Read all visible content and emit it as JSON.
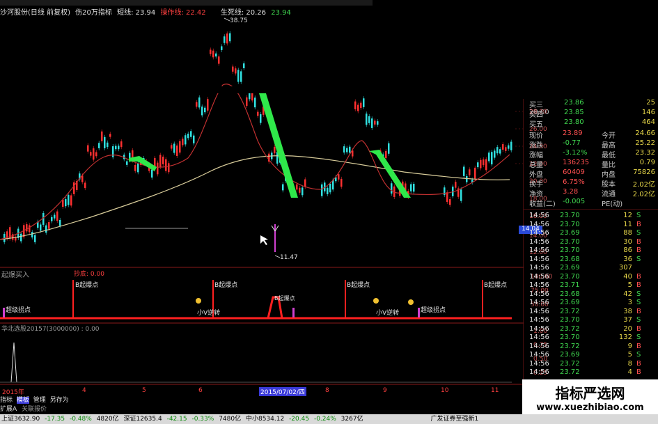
{
  "title_row": {
    "stock": "沙河股份(日线 前复权)",
    "indicator": "伤20万指标",
    "line1_label": "短线: 23.94",
    "line2_label": "操作线: 22.42",
    "line3_label": "生死线: 20.26",
    "line4_value": "23.94"
  },
  "price_labels": {
    "high": "38.75",
    "low": "11.47",
    "current_tag": "14.04"
  },
  "price_axis": [
    "28.00",
    "26.00",
    "24.00",
    "22.00",
    "20.00",
    "18.00",
    "16.00",
    "14.00",
    "12.00"
  ],
  "indicator1": {
    "name": "起爆买入",
    "sub": "抄底: 0.00",
    "axis": [
      "100.00",
      "75.00",
      "50.00"
    ],
    "annotations": [
      "B起爆点",
      "B起爆点",
      "B起爆点",
      "B起爆点",
      "B起爆点"
    ],
    "extra_labels": [
      "超级拐点",
      "小V逆转",
      "小V逆转",
      "超级拐点"
    ]
  },
  "indicator2": {
    "name": "华北选股20157(3000000) : 0.00",
    "axis": [
      "1.00",
      "0.75",
      "0.50",
      "0.25"
    ]
  },
  "time_axis": {
    "year": "2015年",
    "ticks": [
      "4",
      "5",
      "6",
      "8",
      "9",
      "10",
      "11"
    ],
    "cursor": "2015/07/02/四"
  },
  "tabs": [
    "指标",
    "模板",
    "管理",
    "另存为"
  ],
  "tabs2": [
    "扩展A",
    "关联报价"
  ],
  "quote": {
    "buy": [
      {
        "label": "买三",
        "price": "23.86",
        "vol": "25"
      },
      {
        "label": "买四",
        "price": "23.85",
        "vol": "146"
      },
      {
        "label": "买五",
        "price": "23.80",
        "vol": "464"
      }
    ],
    "stats": [
      {
        "l1": "现价",
        "v1": "23.89",
        "l2": "今开",
        "v2": "24.66"
      },
      {
        "l1": "涨跌",
        "v1": "-0.77",
        "l2": "最高",
        "v2": "25.22"
      },
      {
        "l1": "涨幅",
        "v1": "-3.12%",
        "l2": "最低",
        "v2": "23.32"
      },
      {
        "l1": "总量",
        "v1": "136235",
        "l2": "量比",
        "v2": "0.79"
      },
      {
        "l1": "外盘",
        "v1": "60409",
        "l2": "内盘",
        "v2": "75826"
      },
      {
        "l1": "换手",
        "v1": "6.75%",
        "l2": "股本",
        "v2": "2.02亿"
      },
      {
        "l1": "净资",
        "v1": "3.28",
        "l2": "流通",
        "v2": "2.02亿"
      },
      {
        "l1": "收益(二)",
        "v1": "-0.005",
        "l2": "PE(动)",
        "v2": ""
      }
    ]
  },
  "ticks": [
    {
      "t": "14:56",
      "p": "23.70",
      "v": "12",
      "s": "S"
    },
    {
      "t": "14:56",
      "p": "23.70",
      "v": "11",
      "s": "B"
    },
    {
      "t": "14:56",
      "p": "23.69",
      "v": "88",
      "s": "S"
    },
    {
      "t": "14:56",
      "p": "23.70",
      "v": "30",
      "s": "B"
    },
    {
      "t": "14:56",
      "p": "23.70",
      "v": "86",
      "s": "B"
    },
    {
      "t": "14:56",
      "p": "23.68",
      "v": "36",
      "s": "S"
    },
    {
      "t": "14:56",
      "p": "23.69",
      "v": "307",
      "s": ""
    },
    {
      "t": "14:56",
      "p": "23.70",
      "v": "40",
      "s": "B"
    },
    {
      "t": "14:56",
      "p": "23.71",
      "v": "5",
      "s": "B"
    },
    {
      "t": "14:56",
      "p": "23.68",
      "v": "42",
      "s": "S"
    },
    {
      "t": "14:56",
      "p": "23.69",
      "v": "3",
      "s": "S"
    },
    {
      "t": "14:56",
      "p": "23.72",
      "v": "38",
      "s": "B"
    },
    {
      "t": "14:56",
      "p": "23.70",
      "v": "37",
      "s": "S"
    },
    {
      "t": "14:56",
      "p": "23.72",
      "v": "20",
      "s": "B"
    },
    {
      "t": "14:56",
      "p": "23.70",
      "v": "132",
      "s": "S"
    },
    {
      "t": "14:56",
      "p": "23.72",
      "v": "9",
      "s": "B"
    },
    {
      "t": "14:56",
      "p": "23.69",
      "v": "5",
      "s": "S"
    },
    {
      "t": "14:56",
      "p": "23.72",
      "v": "8",
      "s": "B"
    },
    {
      "t": "14:56",
      "p": "23.72",
      "v": "4",
      "s": "B"
    }
  ],
  "status": {
    "sh": "上证3632.90",
    "sh_chg": "-17.35",
    "sh_pct": "-0.48%",
    "sh_amt": "4820亿",
    "sz": "深证12635.4",
    "sz_chg": "-42.15",
    "sz_pct": "-0.33%",
    "sz_amt": "7480亿",
    "zx": "中小8534.12",
    "zx_chg": "-20.45",
    "zx_pct": "-0.24%",
    "zx_amt": "3267亿",
    "broker": "广发证券至强新1"
  },
  "watermark": {
    "cn": "指标严选网",
    "url": "www.xuezhibiao.com"
  }
}
